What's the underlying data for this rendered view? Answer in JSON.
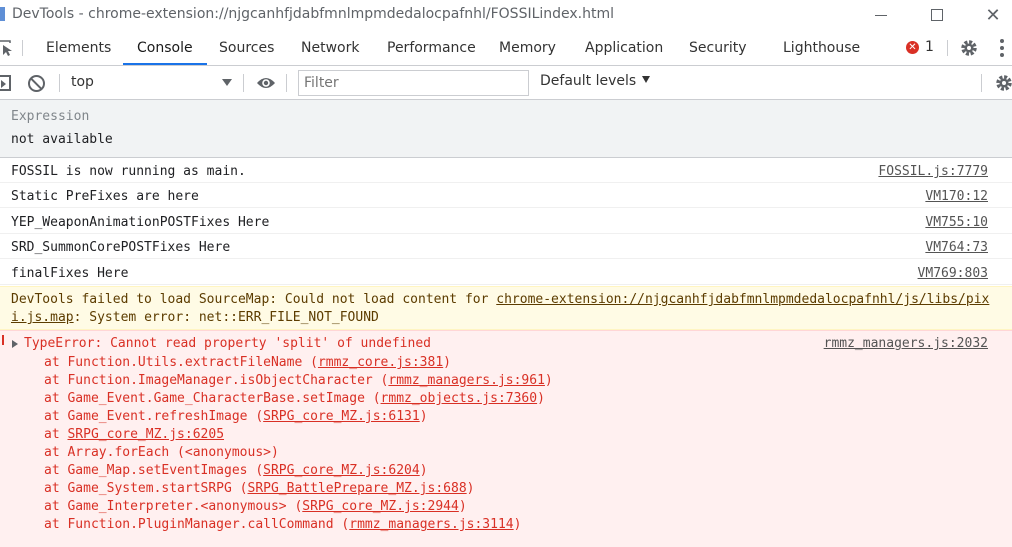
{
  "window": {
    "title": "DevTools - chrome-extension://njgcanhfjdabfmnlmpmdedalocpafnhl/FOSSILindex.html",
    "min_glyph": "",
    "close_glyph": "✕"
  },
  "tabs": [
    {
      "label": "Elements"
    },
    {
      "label": "Console",
      "active": true
    },
    {
      "label": "Sources"
    },
    {
      "label": "Network"
    },
    {
      "label": "Performance"
    },
    {
      "label": "Memory"
    },
    {
      "label": "Application"
    },
    {
      "label": "Security"
    },
    {
      "label": "Lighthouse"
    }
  ],
  "error_badge": {
    "count": "1",
    "glyph": "✕"
  },
  "console_toolbar": {
    "context": "top",
    "filter_placeholder": "Filter",
    "levels_label": "Default levels"
  },
  "live_expression": {
    "label": "Expression",
    "value": "not available"
  },
  "logs": [
    {
      "message": "FOSSIL is now running as main.",
      "source": "FOSSIL.js:7779"
    },
    {
      "message": "Static PreFixes are here",
      "source": "VM170:12"
    },
    {
      "message": "YEP_WeaponAnimationPOSTFixes Here",
      "source": "VM755:10"
    },
    {
      "message": "SRD_SummonCorePOSTFixes Here",
      "source": "VM764:73"
    },
    {
      "message": "finalFixes Here",
      "source": "VM769:803"
    }
  ],
  "warning": {
    "prefix": "DevTools failed to load SourceMap: Could not load content for ",
    "link": "chrome-extension://njgcanhfjdabfmnlmpmdedalocpafnhl/js/libs/pixi.js.map",
    "suffix": ": System error: net::ERR_FILE_NOT_FOUND"
  },
  "error": {
    "message": "TypeError: Cannot read property 'split' of undefined",
    "source": "rmmz_managers.js:2032",
    "stack": [
      {
        "at": "at Function.Utils.extractFileName (",
        "loc": "rmmz_core.js:381",
        "end": ")"
      },
      {
        "at": "at Function.ImageManager.isObjectCharacter (",
        "loc": "rmmz_managers.js:961",
        "end": ")"
      },
      {
        "at": "at Game_Event.Game_CharacterBase.setImage (",
        "loc": "rmmz_objects.js:7360",
        "end": ")"
      },
      {
        "at": "at Game_Event.refreshImage (",
        "loc": "SRPG_core_MZ.js:6131",
        "end": ")"
      },
      {
        "at": "at ",
        "loc": "SRPG_core_MZ.js:6205",
        "end": ""
      },
      {
        "at": "at Array.forEach (<anonymous>)",
        "loc": "",
        "end": ""
      },
      {
        "at": "at Game_Map.setEventImages (",
        "loc": "SRPG_core_MZ.js:6204",
        "end": ")"
      },
      {
        "at": "at Game_System.startSRPG (",
        "loc": "SRPG_BattlePrepare_MZ.js:688",
        "end": ")"
      },
      {
        "at": "at Game_Interpreter.<anonymous> (",
        "loc": "SRPG_core_MZ.js:2944",
        "end": ")"
      },
      {
        "at": "at Function.PluginManager.callCommand (",
        "loc": "rmmz_managers.js:3114",
        "end": ")"
      }
    ]
  },
  "colors": {
    "accent": "#1a73e8",
    "error_text": "#d93025",
    "error_bg": "#fff0f0",
    "warning_bg": "#fffbe5",
    "warning_text": "#5c3c00"
  }
}
